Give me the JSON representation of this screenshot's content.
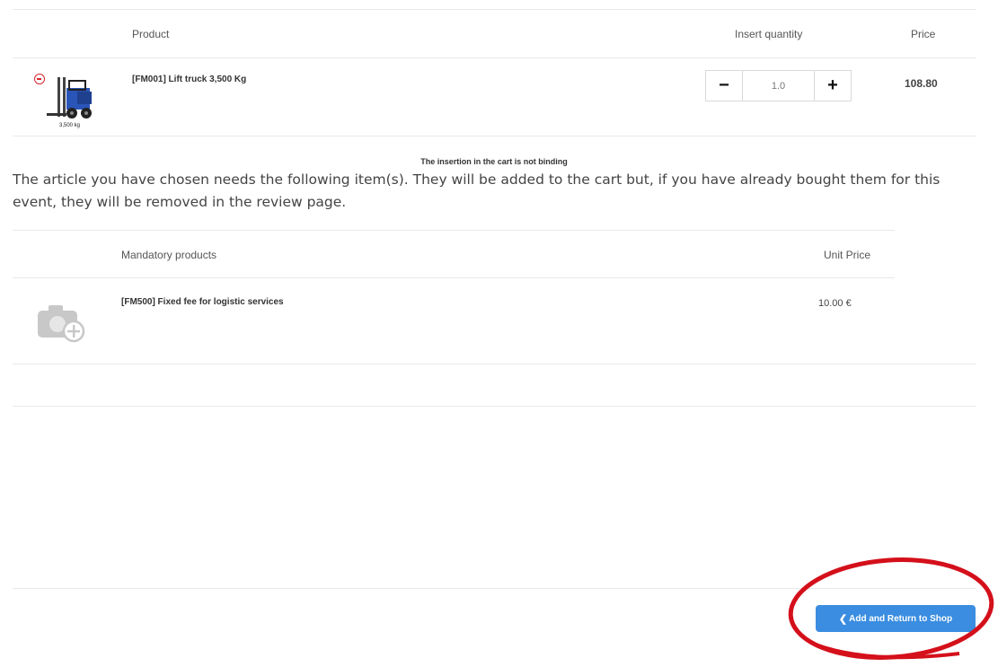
{
  "cart_table": {
    "header_product": "Product",
    "header_quantity": "Insert quantity",
    "header_price": "Price",
    "item": {
      "name": "[FM001] Lift truck 3,500 Kg",
      "image_caption": "3,500 kg",
      "quantity": "1.0",
      "price": "108.80"
    }
  },
  "notice": {
    "binding_note": "The insertion in the cart is not binding",
    "message": "The article you have chosen needs the following item(s). They will be added to the cart but, if you have already bought them for this event, they will be removed in the review page."
  },
  "mandatory_table": {
    "header_products": "Mandatory products",
    "header_unit_price": "Unit Price",
    "item": {
      "name": "[FM500] Fixed fee for logistic services",
      "unit_price": "10.00 €"
    }
  },
  "footer": {
    "return_button_label": "Add and Return to Shop",
    "return_button_icon": "chevron-left-icon"
  },
  "colors": {
    "button_blue": "#3a8de0",
    "highlight_circle": "#d4101b",
    "remove_icon_red": "#d9262d",
    "forklift_blue": "#2a55b8"
  }
}
